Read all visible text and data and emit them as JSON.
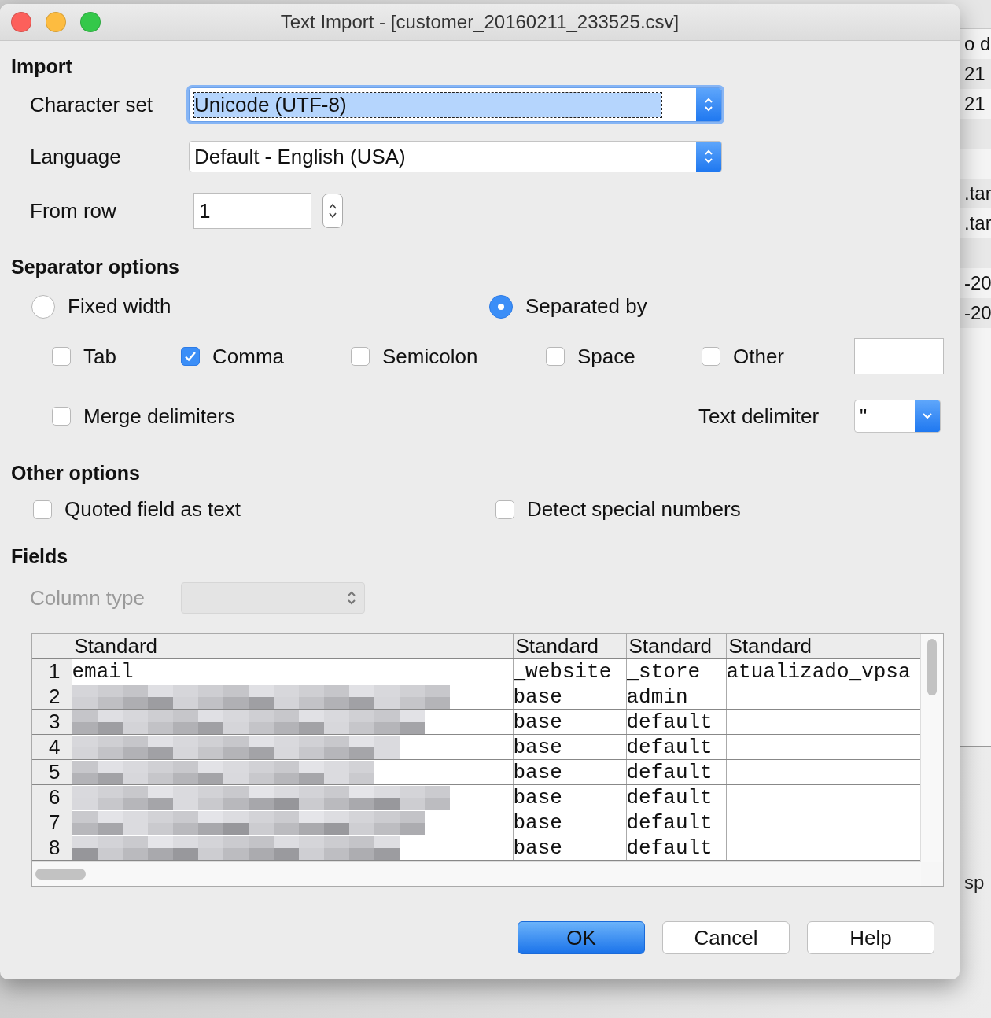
{
  "window": {
    "title": "Text Import - [customer_20160211_233525.csv]"
  },
  "import": {
    "heading": "Import",
    "character_set": {
      "label": "Character set",
      "value": "Unicode (UTF-8)",
      "focused": true
    },
    "language": {
      "label": "Language",
      "value": "Default - English (USA)"
    },
    "from_row": {
      "label": "From row",
      "value": "1"
    }
  },
  "separator_options": {
    "heading": "Separator options",
    "modes": [
      {
        "label": "Fixed width",
        "selected": false
      },
      {
        "label": "Separated by",
        "selected": true
      }
    ],
    "separators": [
      {
        "label": "Tab",
        "checked": false
      },
      {
        "label": "Comma",
        "checked": true
      },
      {
        "label": "Semicolon",
        "checked": false
      },
      {
        "label": "Space",
        "checked": false
      },
      {
        "label": "Other",
        "checked": false
      }
    ],
    "merge_delimiters": {
      "label": "Merge delimiters",
      "checked": false
    },
    "text_delimiter": {
      "label": "Text delimiter",
      "value": "\""
    }
  },
  "other_options": {
    "heading": "Other options",
    "options": [
      {
        "label": "Quoted field as text",
        "checked": false
      },
      {
        "label": "Detect special numbers",
        "checked": false
      }
    ]
  },
  "fields": {
    "heading": "Fields",
    "column_type": {
      "label": "Column type",
      "disabled": true
    },
    "table": {
      "columns": [
        "Standard",
        "Standard",
        "Standard",
        "Standard"
      ],
      "rows": [
        {
          "number": "1",
          "cells": [
            {
              "kind": "text",
              "text": "email"
            },
            {
              "kind": "text",
              "text": "_website"
            },
            {
              "kind": "text",
              "text": "_store"
            },
            {
              "kind": "text",
              "text": "atualizado_vpsa"
            }
          ]
        },
        {
          "number": "2",
          "cells": [
            {
              "kind": "redacted"
            },
            {
              "kind": "text",
              "text": "base"
            },
            {
              "kind": "text",
              "text": "admin"
            }
          ]
        },
        {
          "number": "3",
          "cells": [
            {
              "kind": "redacted"
            },
            {
              "kind": "text",
              "text": "base"
            },
            {
              "kind": "text",
              "text": "default"
            }
          ]
        },
        {
          "number": "4",
          "cells": [
            {
              "kind": "redacted"
            },
            {
              "kind": "text",
              "text": "base"
            },
            {
              "kind": "text",
              "text": "default"
            }
          ]
        },
        {
          "number": "5",
          "cells": [
            {
              "kind": "redacted"
            },
            {
              "kind": "text",
              "text": "base"
            },
            {
              "kind": "text",
              "text": "default"
            }
          ]
        },
        {
          "number": "6",
          "cells": [
            {
              "kind": "redacted"
            },
            {
              "kind": "text",
              "text": "base"
            },
            {
              "kind": "text",
              "text": "default"
            }
          ]
        },
        {
          "number": "7",
          "cells": [
            {
              "kind": "redacted"
            },
            {
              "kind": "text",
              "text": "base"
            },
            {
              "kind": "text",
              "text": "default"
            }
          ]
        },
        {
          "number": "8",
          "cells": [
            {
              "kind": "redacted"
            },
            {
              "kind": "text",
              "text": "base"
            },
            {
              "kind": "text",
              "text": "default"
            }
          ]
        }
      ]
    }
  },
  "buttons": [
    {
      "label": "OK",
      "default": true
    },
    {
      "label": "Cancel",
      "default": false
    },
    {
      "label": "Help",
      "default": false
    }
  ],
  "background_window": {
    "rows": [
      {
        "text": "o d"
      },
      {
        "text": "21"
      },
      {
        "text": "21"
      },
      {},
      {},
      {
        "text": ".tar"
      },
      {
        "text": ".tar"
      },
      {},
      {
        "text": "-20"
      },
      {
        "text": "-20"
      }
    ],
    "footer_text": "sp"
  }
}
